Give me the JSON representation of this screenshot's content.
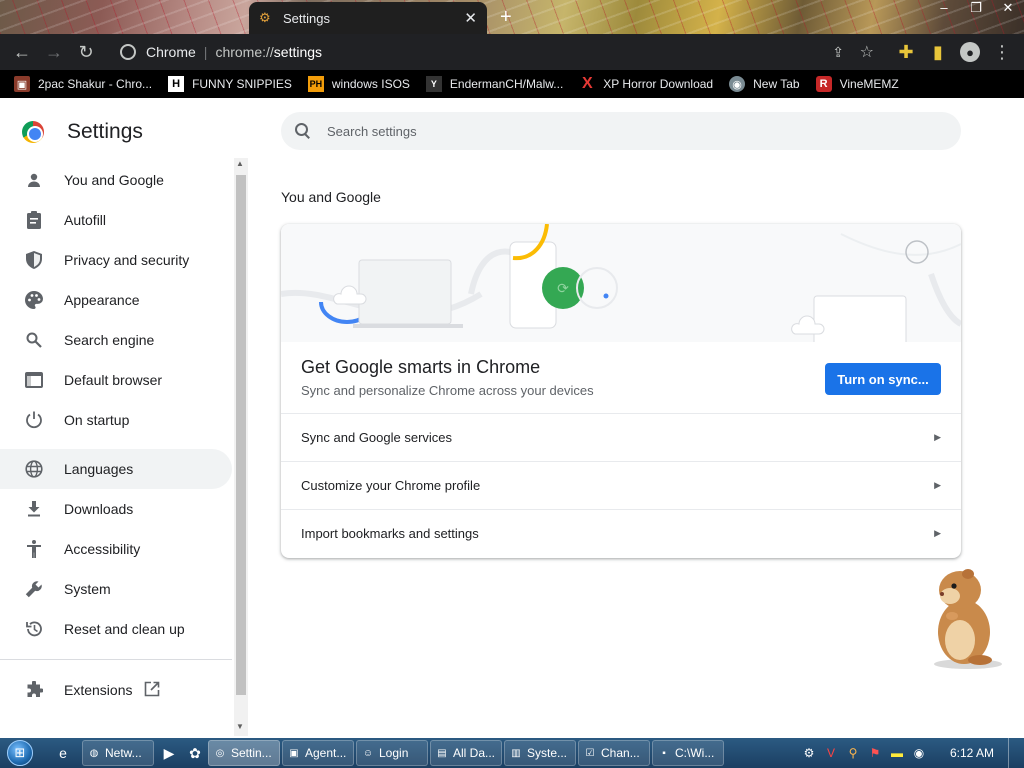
{
  "window": {
    "tab_title": "Settings",
    "tab_close": "✕",
    "new_tab": "+"
  },
  "toolbar": {
    "site_label": "Chrome",
    "url_host": "chrome://",
    "url_path": "settings"
  },
  "bookmarks": [
    {
      "label": "2pac Shakur - Chro...",
      "icon": "▣"
    },
    {
      "label": "FUNNY SNIPPIES",
      "icon": "H"
    },
    {
      "label": "windows ISOS",
      "icon": "PH"
    },
    {
      "label": "EndermanCH/Malw...",
      "icon": "Y"
    },
    {
      "label": "XP Horror Download",
      "icon": "X"
    },
    {
      "label": "New Tab",
      "icon": "◉"
    },
    {
      "label": "VineMEMZ",
      "icon": "R"
    }
  ],
  "settings": {
    "title": "Settings",
    "search_placeholder": "Search settings"
  },
  "sidebar": {
    "items": [
      {
        "label": "You and Google",
        "icon": "person-icon"
      },
      {
        "label": "Autofill",
        "icon": "clipboard-icon"
      },
      {
        "label": "Privacy and security",
        "icon": "shield-icon"
      },
      {
        "label": "Appearance",
        "icon": "palette-icon"
      },
      {
        "label": "Search engine",
        "icon": "search-icon"
      },
      {
        "label": "Default browser",
        "icon": "browser-icon"
      },
      {
        "label": "On startup",
        "icon": "power-icon"
      },
      {
        "label": "Languages",
        "icon": "globe-icon"
      },
      {
        "label": "Downloads",
        "icon": "download-icon"
      },
      {
        "label": "Accessibility",
        "icon": "accessibility-icon"
      },
      {
        "label": "System",
        "icon": "wrench-icon"
      },
      {
        "label": "Reset and clean up",
        "icon": "history-icon"
      }
    ],
    "extensions_label": "Extensions"
  },
  "main": {
    "section_title": "You and Google",
    "sync_heading": "Get Google smarts in Chrome",
    "sync_sub": "Sync and personalize Chrome across your devices",
    "sync_button": "Turn on sync...",
    "rows": [
      "Sync and Google services",
      "Customize your Chrome profile",
      "Import bookmarks and settings"
    ]
  },
  "taskbar": {
    "tasks": [
      "Netw...",
      "Settin...",
      "Agent...",
      "Login",
      "All Da...",
      "Syste...",
      "Chan...",
      "C:\\Wi..."
    ],
    "clock": "6:12 AM"
  },
  "colors": {
    "accent": "#1a73e8",
    "toolbar_bg": "#202124",
    "bookmarks_bg": "#000000"
  }
}
